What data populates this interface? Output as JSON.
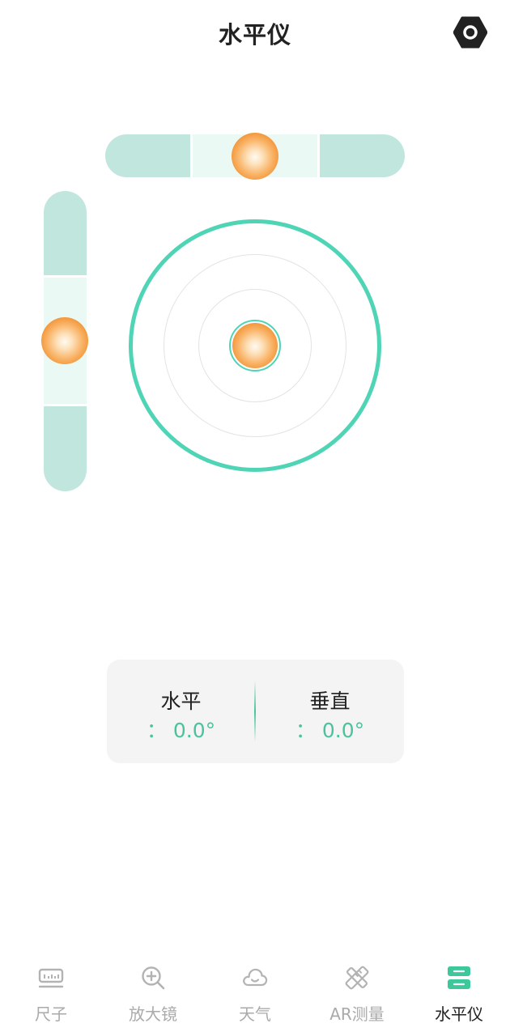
{
  "header": {
    "title": "水平仪",
    "settings_icon": "settings-hex-icon"
  },
  "level": {
    "horizontal_reading": 0.0,
    "vertical_reading": 0.0
  },
  "readout": {
    "horizontal_label": "水平",
    "horizontal_value": "： 0.0°",
    "vertical_label": "垂直",
    "vertical_value": "： 0.0°"
  },
  "tabs": [
    {
      "label": "尺子",
      "icon": "ruler-icon",
      "active": false
    },
    {
      "label": "放大镜",
      "icon": "magnifier-icon",
      "active": false
    },
    {
      "label": "天气",
      "icon": "cloud-icon",
      "active": false
    },
    {
      "label": "AR测量",
      "icon": "ar-ruler-icon",
      "active": false
    },
    {
      "label": "水平仪",
      "icon": "level-icon",
      "active": true
    }
  ],
  "colors": {
    "accent": "#4fd4b5",
    "value_text": "#4ac39d",
    "tube": "#c0e6de",
    "tube_window": "#ebf9f5",
    "bubble": "#f08c2b",
    "tab_inactive": "#aaaaaa",
    "tab_active": "#222222"
  }
}
